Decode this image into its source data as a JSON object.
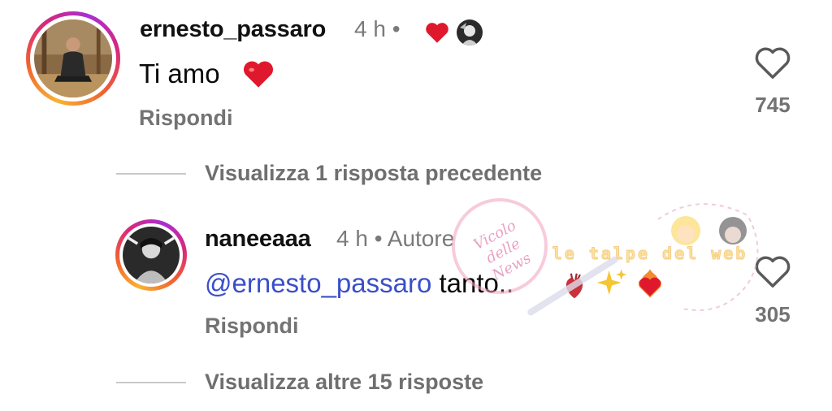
{
  "comments": [
    {
      "username": "ernesto_passaro",
      "time": "4 h",
      "separator": "•",
      "text": "Ti amo",
      "text_emoji": "❤️",
      "reply_label": "Rispondi",
      "likes": "745",
      "liked_by_author_icon": "red-heart-icon"
    },
    {
      "username": "naneeaaa",
      "time": "4 h",
      "separator": "•",
      "author_label": "Autore",
      "mention": "@ernesto_passaro",
      "text": " tanto..",
      "reply_label": "Rispondi",
      "likes": "305"
    }
  ],
  "view_previous": "Visualizza 1 risposta precedente",
  "view_more": "Visualizza altre 15 risposte",
  "watermarks": {
    "circle_text": "Vicolo delle News",
    "banner_text": "le talpe del web"
  },
  "colors": {
    "mention": "#3a4fc9",
    "heart": "#e0182d",
    "ring_start": "#f9b233",
    "ring_end": "#a92ed2"
  }
}
